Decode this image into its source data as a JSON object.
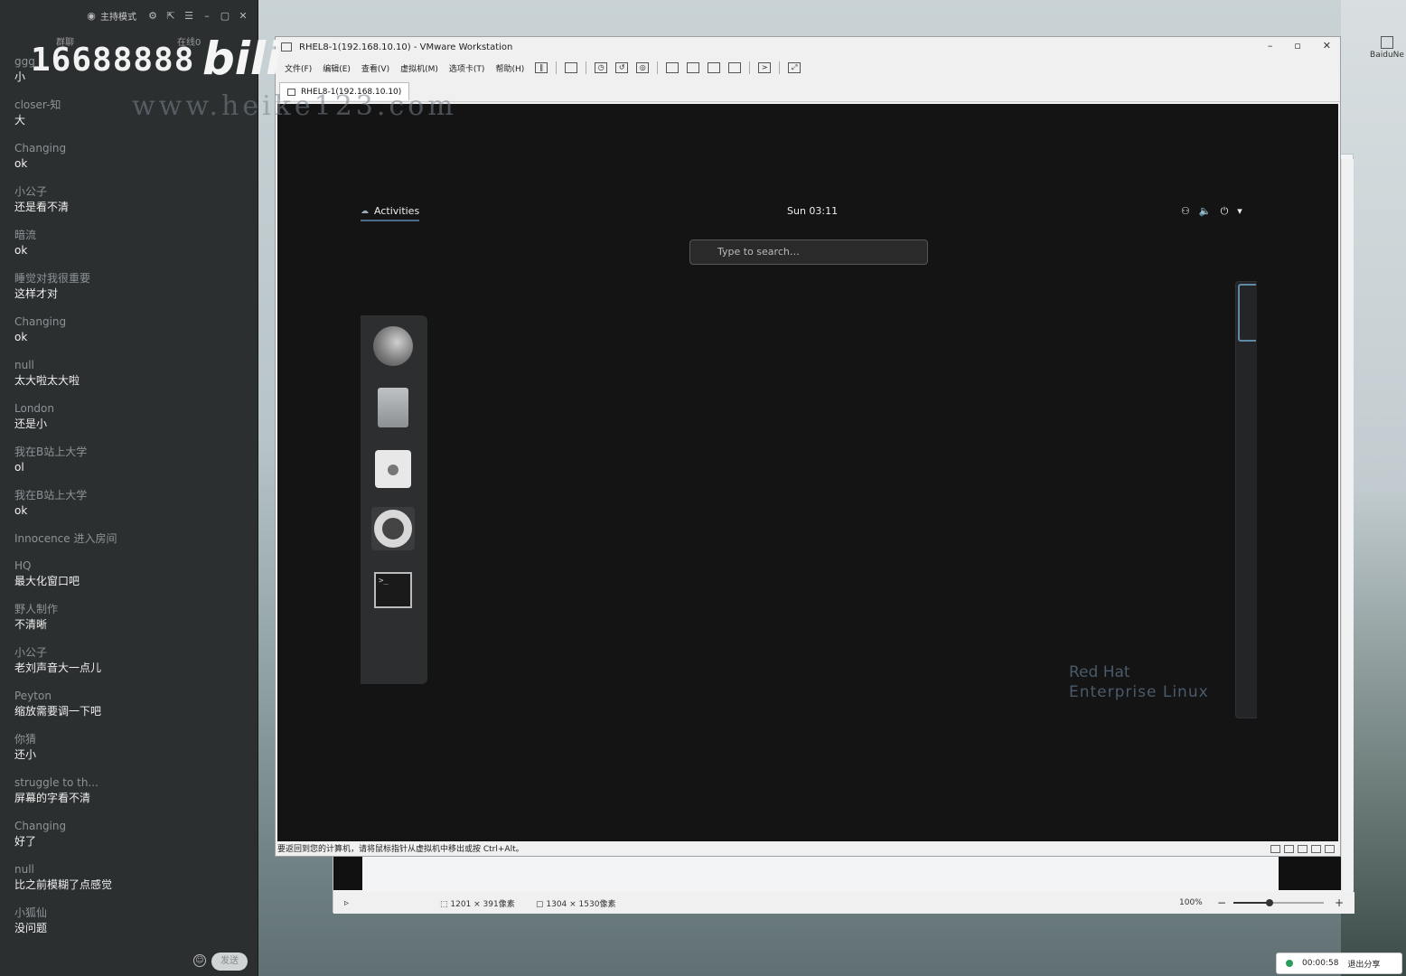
{
  "chat": {
    "mode_label": "主持模式",
    "tab_left": "群聊",
    "tab_right": "在线0",
    "watermark_number": "16688888",
    "watermark_logo": "bili",
    "watermark_url": "www.heike123.com",
    "messages": [
      {
        "user": "ggg",
        "text": "小"
      },
      {
        "user": "closer-知",
        "text": "大"
      },
      {
        "user": "Changing",
        "text": "ok"
      },
      {
        "user": "小公子",
        "text": "还是看不清"
      },
      {
        "user": "暗流",
        "text": "ok"
      },
      {
        "user": "睡觉对我很重要",
        "text": "这样才对"
      },
      {
        "user": "Changing",
        "text": "ok"
      },
      {
        "user": "null",
        "text": "太大啦太大啦"
      },
      {
        "user": "London",
        "text": "还是小"
      },
      {
        "user": "我在B站上大学",
        "text": "ol"
      },
      {
        "user": "我在B站上大学",
        "text": "ok"
      },
      {
        "user": "Innocence 进入房间",
        "text": ""
      },
      {
        "user": "HQ",
        "text": "最大化窗口吧"
      },
      {
        "user": "野人制作",
        "text": "不清晰"
      },
      {
        "user": "小公子",
        "text": "老刘声音大一点儿"
      },
      {
        "user": "Peyton",
        "text": "缩放需要调一下吧"
      },
      {
        "user": "你猜",
        "text": "还小"
      },
      {
        "user": "struggle to th...",
        "text": "屏幕的字看不清"
      },
      {
        "user": "Changing",
        "text": "好了"
      },
      {
        "user": "null",
        "text": "比之前模糊了点感觉"
      },
      {
        "user": "小狐仙",
        "text": "没问题"
      }
    ],
    "send_label": "发送"
  },
  "vmware": {
    "title": "RHEL8-1(192.168.10.10) - VMware Workstation",
    "menus": [
      "文件(F)",
      "编辑(E)",
      "查看(V)",
      "虚拟机(M)",
      "选项卡(T)",
      "帮助(H)"
    ],
    "tab_label": "RHEL8-1(192.168.10.10)",
    "statusbar_text": "要返回到您的计算机，请将鼠标指针从虚拟机中移出或按 Ctrl+Alt。"
  },
  "gnome": {
    "activities": "Activities",
    "clock": "Sun 03:11",
    "search_placeholder": "Type to search…",
    "logo_line1": "Red Hat",
    "logo_line2": "Enterprise Linux",
    "dash_apps": [
      "firefox-icon",
      "files-icon",
      "software-icon",
      "help-icon",
      "terminal-icon"
    ],
    "terminal_glyph": ">_"
  },
  "viewer": {
    "size_selection": "1201 × 391像素",
    "size_image": "1304 × 1530像素",
    "zoom": "100%",
    "zoom_fraction": 0.4
  },
  "desktop": {
    "icon_label": "BaiduNe"
  },
  "share": {
    "timer": "00:00:58",
    "exit_label": "退出分享"
  }
}
